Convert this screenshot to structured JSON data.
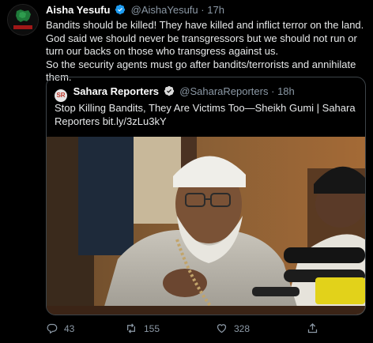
{
  "tweet": {
    "author_name": "Aisha Yesufu",
    "author_handle": "@AishaYesufu",
    "separator": "·",
    "time": "17h",
    "avatar_label": "END SARS",
    "body_lines": [
      "Bandits should be killed! They have killed and inflict terror on the land. God said we should never be transgressors but we should not run or turn our backs on those who transgress against us.",
      "So the security agents must go after bandits/terrorists and annihilate them."
    ]
  },
  "quote": {
    "avatar_label": "SR",
    "author_name": "Sahara Reporters",
    "author_handle": "@SaharaReporters",
    "separator": "·",
    "time": "18h",
    "text": "Stop Killing Bandits, They Are Victims Too—Sheikh Gumi | Sahara Reporters bit.ly/3zLu3kY"
  },
  "actions": {
    "reply_count": "43",
    "retweet_count": "155",
    "like_count": "328"
  },
  "colors": {
    "background": "#000000",
    "text_primary": "#e7e9ea",
    "text_secondary": "#8b98a5",
    "verified_blue": "#1d9bf0",
    "border": "#3d4449"
  },
  "icons": [
    "verified-badge-icon",
    "reply-icon",
    "retweet-icon",
    "like-icon",
    "share-icon"
  ]
}
